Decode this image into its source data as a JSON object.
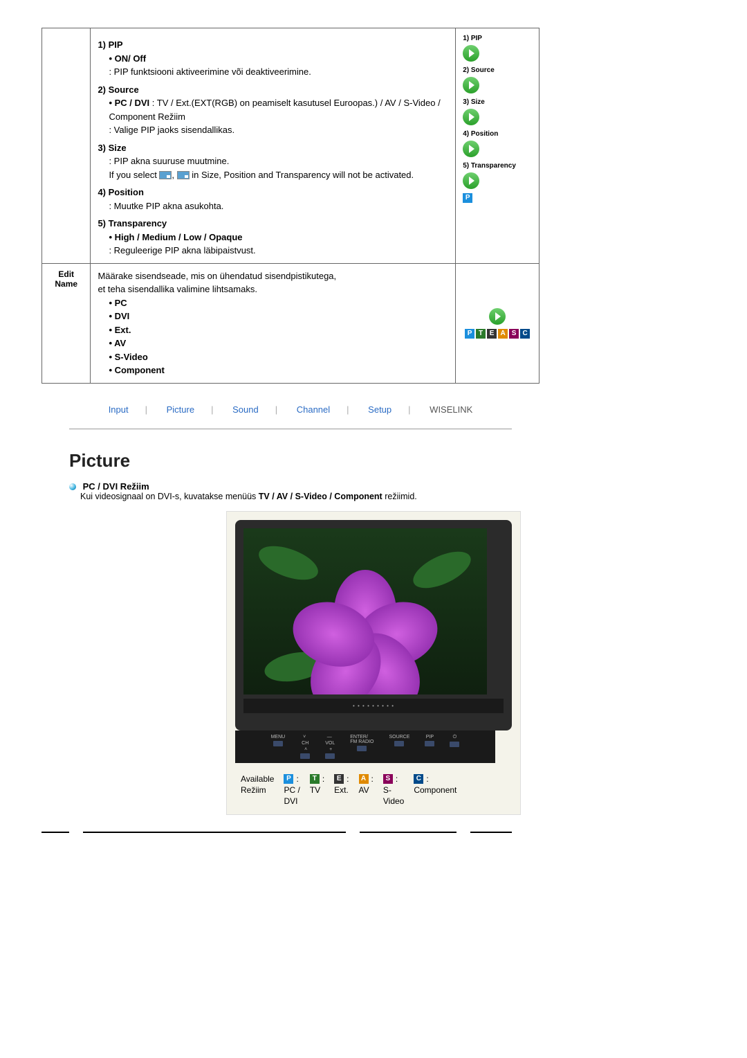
{
  "table1": {
    "row1": {
      "items": [
        {
          "head": "1) PIP",
          "bullet": "• ON/ Off",
          "desc": ": PIP funktsiooni aktiveerimine või deaktiveerimine."
        },
        {
          "head": "2) Source",
          "bullet": "• PC / DVI",
          "bullet_tail": " : TV / Ext.(EXT(RGB) on peamiselt kasutusel Euroopas.) / AV / S-Video / Component Režiim",
          "desc": ": Valige PIP jaoks sisendallikas."
        },
        {
          "head": "3) Size",
          "desc1": ": PIP akna suuruse muutmine.",
          "desc2a": "If you select ",
          "desc2b": " in Size, Position and Transparency will not be activated."
        },
        {
          "head": "4) Position",
          "desc": ": Muutke PIP akna asukohta."
        },
        {
          "head": "5) Transparency",
          "bullet": "• High / Medium / Low / Opaque",
          "desc": ": Reguleerige PIP akna läbipaistvust."
        }
      ],
      "side": [
        "1) PIP",
        "2) Source",
        "3) Size",
        "4) Position",
        "5) Transparency"
      ]
    },
    "row2": {
      "label1": "Edit",
      "label2": "Name",
      "desc1": "Määrake sisendseade, mis on ühendatud sisendpistikutega,",
      "desc2": "et teha sisendallika valimine lihtsamaks.",
      "bullets": [
        "• PC",
        "• DVI",
        "• Ext.",
        "• AV",
        "• S-Video",
        "• Component"
      ]
    }
  },
  "navtabs": [
    "Input",
    "Picture",
    "Sound",
    "Channel",
    "Setup",
    "WISELINK"
  ],
  "section": {
    "title": "Picture",
    "mode_head": "PC / DVI Režiim",
    "mode_desc_a": "Kui videosignaal on DVI-s, kuvatakse menüüs ",
    "mode_desc_b": "TV / AV / S-Video / Component",
    "mode_desc_c": " režiimid."
  },
  "monitor_buttons": [
    "MENU",
    "CH",
    "VOL",
    "ENTER/\nFM RADIO",
    "SOURCE",
    "PIP",
    "⏻"
  ],
  "avail": {
    "l1": "Available",
    "l2": "Režiim",
    "cols": [
      {
        "letter": "P",
        "cls": "pb",
        "t1": "PC /",
        "t2": "DVI"
      },
      {
        "letter": "T",
        "cls": "tb",
        "t1": "TV",
        "t2": ""
      },
      {
        "letter": "E",
        "cls": "eb",
        "t1": "Ext.",
        "t2": ""
      },
      {
        "letter": "A",
        "cls": "ab",
        "t1": "AV",
        "t2": ""
      },
      {
        "letter": "S",
        "cls": "sb",
        "t1": "S-",
        "t2": "Video"
      },
      {
        "letter": "C",
        "cls": "cb",
        "t1": "Component",
        "t2": ""
      }
    ]
  }
}
